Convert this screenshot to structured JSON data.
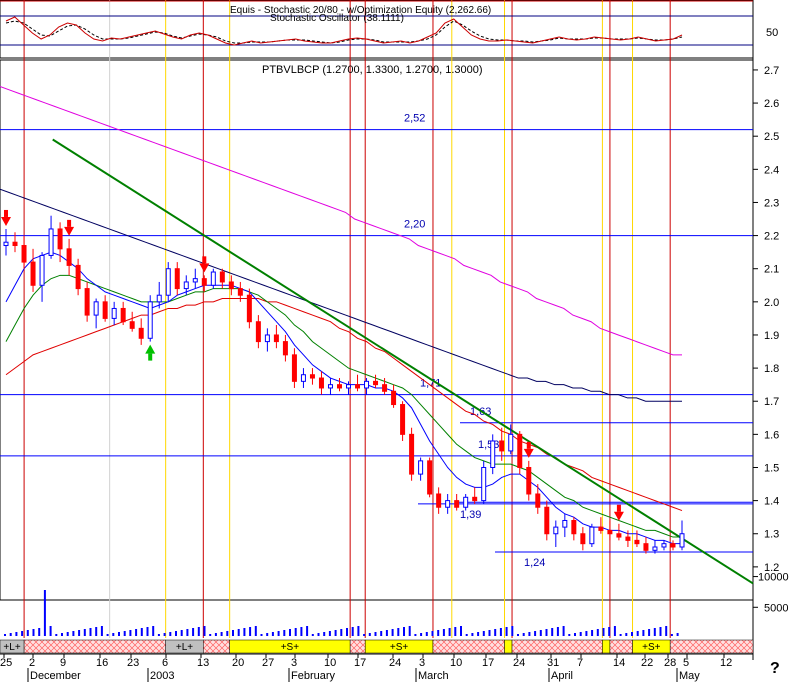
{
  "chart_data": {
    "type": "candlestick",
    "stochastic_panel": {
      "title": "Equis - Stochastic 20/80 - w/Optimization Equity (2,262.66)",
      "subtitle": "Stochastic Oscillator (38.1111)",
      "y_ticks": [
        "50"
      ],
      "k": [
        62,
        66,
        58,
        50,
        44,
        48,
        56,
        60,
        58,
        50,
        44,
        42,
        45,
        44,
        46,
        48,
        50,
        52,
        49,
        46,
        44,
        48,
        50,
        48,
        44,
        40,
        38,
        40,
        42,
        40,
        41,
        42,
        43,
        44,
        42,
        41,
        40,
        40,
        42,
        44,
        45,
        44,
        42,
        40,
        41,
        42,
        40,
        42,
        46,
        50,
        60,
        64,
        56,
        48,
        44,
        42,
        42,
        43,
        42,
        41,
        40,
        42,
        44,
        46,
        44,
        43,
        44,
        46,
        45,
        44,
        43,
        44,
        46,
        44,
        42,
        43,
        44,
        48
      ],
      "d": [
        60,
        62,
        60,
        54,
        48,
        47,
        52,
        57,
        58,
        54,
        48,
        44,
        44,
        44,
        45,
        47,
        49,
        51,
        50,
        47,
        45,
        47,
        49,
        48,
        46,
        42,
        40,
        40,
        41,
        41,
        41,
        42,
        43,
        43,
        43,
        42,
        41,
        40,
        41,
        43,
        44,
        44,
        43,
        41,
        41,
        41,
        41,
        42,
        44,
        48,
        56,
        62,
        58,
        52,
        47,
        44,
        43,
        43,
        42,
        42,
        41,
        42,
        43,
        45,
        44,
        44,
        44,
        45,
        45,
        44,
        44,
        44,
        45,
        44,
        43,
        43,
        44,
        46
      ]
    },
    "price_panel": {
      "title": "PTBVLBCP (1.2700, 1.3300, 1.2700, 1.3000)",
      "y_ticks": [
        "2.7",
        "2.6",
        "2.5",
        "2.4",
        "2.3",
        "2.2",
        "2.1",
        "2.0",
        "1.9",
        "1.8",
        "1.7",
        "1.6",
        "1.5",
        "1.4",
        "1.3",
        "1.2"
      ],
      "ylim": [
        1.1,
        2.73
      ],
      "levels": [
        {
          "label": "2,52",
          "value": 2.52
        },
        {
          "label": "2,20",
          "value": 2.2
        },
        {
          "label": "1,71",
          "value": 1.72
        },
        {
          "label": "1,63",
          "value": 1.635
        },
        {
          "label": "1,53",
          "value": 1.535
        },
        {
          "label": "1,39",
          "value": 1.39
        },
        {
          "label": "1,24",
          "value": 1.245
        }
      ],
      "candles": [
        [
          2.17,
          2.22,
          2.14,
          2.18
        ],
        [
          2.18,
          2.21,
          2.15,
          2.17
        ],
        [
          2.17,
          2.2,
          2.1,
          2.12
        ],
        [
          2.12,
          2.16,
          2.03,
          2.05
        ],
        [
          2.05,
          2.15,
          2.0,
          2.14
        ],
        [
          2.14,
          2.26,
          2.13,
          2.22
        ],
        [
          2.22,
          2.24,
          2.12,
          2.16
        ],
        [
          2.16,
          2.19,
          2.08,
          2.11
        ],
        [
          2.11,
          2.13,
          2.02,
          2.04
        ],
        [
          2.04,
          2.06,
          1.94,
          1.96
        ],
        [
          1.96,
          2.01,
          1.92,
          2.0
        ],
        [
          2.0,
          2.02,
          1.94,
          1.95
        ],
        [
          1.95,
          2.0,
          1.93,
          1.98
        ],
        [
          1.98,
          2.0,
          1.93,
          1.94
        ],
        [
          1.94,
          1.97,
          1.91,
          1.92
        ],
        [
          1.92,
          1.95,
          1.87,
          1.89
        ],
        [
          1.89,
          2.02,
          1.88,
          2.0
        ],
        [
          2.0,
          2.06,
          1.98,
          2.02
        ],
        [
          2.02,
          2.12,
          2.0,
          2.1
        ],
        [
          2.1,
          2.12,
          2.02,
          2.04
        ],
        [
          2.04,
          2.08,
          2.02,
          2.06
        ],
        [
          2.06,
          2.1,
          2.04,
          2.07
        ],
        [
          2.07,
          2.08,
          2.03,
          2.05
        ],
        [
          2.05,
          2.1,
          2.04,
          2.09
        ],
        [
          2.09,
          2.1,
          2.04,
          2.06
        ],
        [
          2.06,
          2.08,
          2.02,
          2.04
        ],
        [
          2.04,
          2.06,
          2.0,
          2.02
        ],
        [
          2.02,
          2.04,
          1.92,
          1.94
        ],
        [
          1.94,
          1.96,
          1.86,
          1.88
        ],
        [
          1.88,
          1.92,
          1.85,
          1.9
        ],
        [
          1.9,
          1.93,
          1.86,
          1.88
        ],
        [
          1.88,
          1.9,
          1.82,
          1.84
        ],
        [
          1.84,
          1.86,
          1.74,
          1.76
        ],
        [
          1.76,
          1.8,
          1.74,
          1.78
        ],
        [
          1.78,
          1.8,
          1.75,
          1.77
        ],
        [
          1.77,
          1.79,
          1.72,
          1.74
        ],
        [
          1.74,
          1.77,
          1.72,
          1.75
        ],
        [
          1.75,
          1.77,
          1.73,
          1.74
        ],
        [
          1.74,
          1.76,
          1.72,
          1.75
        ],
        [
          1.75,
          1.78,
          1.73,
          1.74
        ],
        [
          1.74,
          1.77,
          1.72,
          1.76
        ],
        [
          1.76,
          1.78,
          1.74,
          1.75
        ],
        [
          1.75,
          1.77,
          1.72,
          1.73
        ],
        [
          1.73,
          1.75,
          1.68,
          1.69
        ],
        [
          1.69,
          1.7,
          1.58,
          1.6
        ],
        [
          1.6,
          1.62,
          1.46,
          1.48
        ],
        [
          1.48,
          1.53,
          1.46,
          1.52
        ],
        [
          1.52,
          1.53,
          1.41,
          1.42
        ],
        [
          1.42,
          1.44,
          1.36,
          1.38
        ],
        [
          1.38,
          1.42,
          1.36,
          1.4
        ],
        [
          1.4,
          1.42,
          1.37,
          1.38
        ],
        [
          1.38,
          1.42,
          1.37,
          1.41
        ],
        [
          1.41,
          1.44,
          1.39,
          1.4
        ],
        [
          1.4,
          1.52,
          1.39,
          1.5
        ],
        [
          1.5,
          1.6,
          1.48,
          1.58
        ],
        [
          1.58,
          1.62,
          1.52,
          1.55
        ],
        [
          1.55,
          1.63,
          1.54,
          1.6
        ],
        [
          1.6,
          1.61,
          1.48,
          1.5
        ],
        [
          1.5,
          1.52,
          1.4,
          1.42
        ],
        [
          1.42,
          1.45,
          1.36,
          1.38
        ],
        [
          1.38,
          1.4,
          1.28,
          1.3
        ],
        [
          1.3,
          1.34,
          1.26,
          1.32
        ],
        [
          1.32,
          1.36,
          1.29,
          1.34
        ],
        [
          1.34,
          1.35,
          1.28,
          1.3
        ],
        [
          1.3,
          1.32,
          1.25,
          1.27
        ],
        [
          1.27,
          1.33,
          1.26,
          1.32
        ],
        [
          1.32,
          1.35,
          1.3,
          1.31
        ],
        [
          1.31,
          1.34,
          1.28,
          1.3
        ],
        [
          1.3,
          1.33,
          1.28,
          1.29
        ],
        [
          1.29,
          1.31,
          1.26,
          1.28
        ],
        [
          1.28,
          1.31,
          1.26,
          1.27
        ],
        [
          1.27,
          1.29,
          1.24,
          1.25
        ],
        [
          1.25,
          1.28,
          1.24,
          1.26
        ],
        [
          1.26,
          1.28,
          1.25,
          1.27
        ],
        [
          1.27,
          1.28,
          1.25,
          1.26
        ],
        [
          1.26,
          1.34,
          1.25,
          1.3
        ]
      ],
      "ma_blue": [
        2.0,
        2.05,
        2.1,
        2.13,
        2.14,
        2.15,
        2.14,
        2.12,
        2.1,
        2.07,
        2.05,
        2.03,
        2.02,
        2.01,
        2.0,
        1.99,
        1.98,
        1.99,
        2.0,
        2.02,
        2.03,
        2.04,
        2.05,
        2.05,
        2.05,
        2.05,
        2.04,
        2.03,
        2.0,
        1.97,
        1.94,
        1.91,
        1.87,
        1.84,
        1.81,
        1.79,
        1.77,
        1.76,
        1.75,
        1.75,
        1.75,
        1.74,
        1.74,
        1.73,
        1.71,
        1.68,
        1.63,
        1.58,
        1.54,
        1.5,
        1.47,
        1.45,
        1.44,
        1.44,
        1.45,
        1.47,
        1.48,
        1.48,
        1.46,
        1.44,
        1.41,
        1.38,
        1.36,
        1.35,
        1.33,
        1.32,
        1.32,
        1.31,
        1.31,
        1.3,
        1.3,
        1.29,
        1.28,
        1.28,
        1.27,
        1.27
      ],
      "ma_green": [
        1.88,
        1.93,
        1.98,
        2.02,
        2.05,
        2.07,
        2.08,
        2.08,
        2.07,
        2.06,
        2.05,
        2.04,
        2.03,
        2.02,
        2.01,
        2.0,
        2.0,
        2.0,
        2.0,
        2.01,
        2.02,
        2.03,
        2.03,
        2.04,
        2.04,
        2.04,
        2.04,
        2.03,
        2.02,
        2.0,
        1.98,
        1.96,
        1.93,
        1.91,
        1.88,
        1.86,
        1.84,
        1.82,
        1.8,
        1.79,
        1.78,
        1.77,
        1.76,
        1.75,
        1.74,
        1.72,
        1.69,
        1.66,
        1.63,
        1.6,
        1.57,
        1.55,
        1.53,
        1.52,
        1.51,
        1.51,
        1.51,
        1.5,
        1.49,
        1.47,
        1.45,
        1.43,
        1.41,
        1.4,
        1.38,
        1.37,
        1.36,
        1.35,
        1.34,
        1.33,
        1.32,
        1.31,
        1.31,
        1.3,
        1.29,
        1.29
      ],
      "ma_red": [
        1.78,
        1.8,
        1.82,
        1.84,
        1.85,
        1.86,
        1.87,
        1.88,
        1.89,
        1.9,
        1.91,
        1.92,
        1.93,
        1.94,
        1.95,
        1.96,
        1.96,
        1.97,
        1.98,
        1.98,
        1.99,
        1.99,
        2.0,
        2.0,
        2.01,
        2.01,
        2.01,
        2.01,
        2.01,
        2.0,
        2.0,
        1.99,
        1.98,
        1.97,
        1.96,
        1.95,
        1.94,
        1.92,
        1.91,
        1.89,
        1.88,
        1.86,
        1.85,
        1.83,
        1.81,
        1.79,
        1.77,
        1.75,
        1.73,
        1.71,
        1.69,
        1.67,
        1.66,
        1.64,
        1.63,
        1.61,
        1.6,
        1.58,
        1.57,
        1.56,
        1.54,
        1.53,
        1.51,
        1.5,
        1.49,
        1.47,
        1.46,
        1.45,
        1.44,
        1.43,
        1.42,
        1.41,
        1.4,
        1.39,
        1.38,
        1.37
      ],
      "ma_navy": [
        2.34,
        2.33,
        2.32,
        2.31,
        2.3,
        2.29,
        2.28,
        2.27,
        2.26,
        2.25,
        2.24,
        2.23,
        2.22,
        2.21,
        2.2,
        2.19,
        2.18,
        2.17,
        2.16,
        2.15,
        2.14,
        2.13,
        2.12,
        2.11,
        2.1,
        2.09,
        2.08,
        2.07,
        2.06,
        2.05,
        2.04,
        2.03,
        2.02,
        2.01,
        2.0,
        1.99,
        1.98,
        1.97,
        1.96,
        1.95,
        1.94,
        1.93,
        1.92,
        1.91,
        1.9,
        1.89,
        1.88,
        1.87,
        1.86,
        1.85,
        1.84,
        1.83,
        1.82,
        1.81,
        1.8,
        1.79,
        1.78,
        1.77,
        1.77,
        1.76,
        1.76,
        1.75,
        1.75,
        1.74,
        1.74,
        1.73,
        1.73,
        1.72,
        1.72,
        1.71,
        1.71,
        1.7,
        1.7,
        1.7,
        1.7,
        1.7
      ],
      "ma_magenta": [
        2.65,
        2.64,
        2.63,
        2.62,
        2.61,
        2.6,
        2.59,
        2.58,
        2.57,
        2.56,
        2.55,
        2.54,
        2.53,
        2.52,
        2.51,
        2.5,
        2.49,
        2.48,
        2.47,
        2.46,
        2.45,
        2.44,
        2.43,
        2.42,
        2.41,
        2.4,
        2.39,
        2.38,
        2.37,
        2.36,
        2.35,
        2.34,
        2.33,
        2.32,
        2.31,
        2.3,
        2.29,
        2.28,
        2.27,
        2.25,
        2.24,
        2.23,
        2.22,
        2.21,
        2.2,
        2.19,
        2.17,
        2.16,
        2.15,
        2.14,
        2.13,
        2.11,
        2.1,
        2.09,
        2.08,
        2.06,
        2.05,
        2.04,
        2.03,
        2.01,
        2.0,
        1.99,
        1.98,
        1.96,
        1.95,
        1.94,
        1.92,
        1.91,
        1.9,
        1.89,
        1.88,
        1.87,
        1.86,
        1.85,
        1.84,
        1.84
      ],
      "trendline": {
        "start": [
          0.07,
          2.49
        ],
        "end": [
          1.0,
          1.15
        ]
      },
      "red_vlines": [
        0.032,
        0.27,
        0.465,
        0.485,
        0.575,
        0.68,
        0.81,
        0.89
      ],
      "yellow_vlines": [
        0.22,
        0.305,
        0.6,
        0.67,
        0.8,
        0.84
      ],
      "silver_vlines": [
        0.22
      ],
      "markers": [
        {
          "type": "sell-arrow",
          "bar": 0
        },
        {
          "type": "sell-arrow",
          "bar": 7
        },
        {
          "type": "buy-arrow",
          "bar": 16
        },
        {
          "type": "sell-arrow",
          "bar": 22
        },
        {
          "type": "sell-arrow",
          "bar": 58
        },
        {
          "type": "sell-arrow",
          "bar": 68
        }
      ]
    },
    "volume_panel": {
      "y_ticks": [
        "10000",
        "5000"
      ],
      "ylim": [
        0,
        14000
      ]
    },
    "signal_bands": [
      {
        "label": "+L+",
        "from": 0.0,
        "to": 0.032,
        "color": "#c0c0c0"
      },
      {
        "label": "",
        "from": 0.032,
        "to": 0.22,
        "color": "#ffc8c8"
      },
      {
        "label": "+L+",
        "from": 0.22,
        "to": 0.27,
        "color": "#c0c0c0"
      },
      {
        "label": "",
        "from": 0.27,
        "to": 0.305,
        "color": "#ffc8c8"
      },
      {
        "label": "+S+",
        "from": 0.305,
        "to": 0.465,
        "color": "#ffff00"
      },
      {
        "label": "",
        "from": 0.465,
        "to": 0.485,
        "color": "#ffc8c8"
      },
      {
        "label": "+S+",
        "from": 0.485,
        "to": 0.575,
        "color": "#ffff00"
      },
      {
        "label": "",
        "from": 0.575,
        "to": 0.67,
        "color": "#ffc8c8"
      },
      {
        "label": "",
        "from": 0.67,
        "to": 0.68,
        "color": "#ffff00"
      },
      {
        "label": "",
        "from": 0.68,
        "to": 0.8,
        "color": "#ffc8c8"
      },
      {
        "label": "",
        "from": 0.8,
        "to": 0.81,
        "color": "#ffff00"
      },
      {
        "label": "",
        "from": 0.81,
        "to": 0.84,
        "color": "#ffc8c8"
      },
      {
        "label": "+S+",
        "from": 0.84,
        "to": 0.89,
        "color": "#ffff00"
      },
      {
        "label": "",
        "from": 0.89,
        "to": 1.0,
        "color": "#ffc8c8"
      }
    ],
    "x_axis": {
      "day_ticks": [
        "25",
        "2",
        "9",
        "16",
        "23",
        "6",
        "13",
        "20",
        "27",
        "3",
        "10",
        "17",
        "24",
        "3",
        "10",
        "17",
        "24",
        "31",
        "7",
        "14",
        "22",
        "28",
        "5",
        "12"
      ],
      "month_labels": [
        "December",
        "2003",
        "February",
        "March",
        "April",
        "May"
      ],
      "trailing_mark": "?"
    },
    "colors": {
      "up": "#0000ff",
      "down": "#ff0000",
      "trend": "#008000",
      "level": "#0000ff",
      "red_line": "#cc0000",
      "yellow_line": "#ffd800"
    }
  }
}
